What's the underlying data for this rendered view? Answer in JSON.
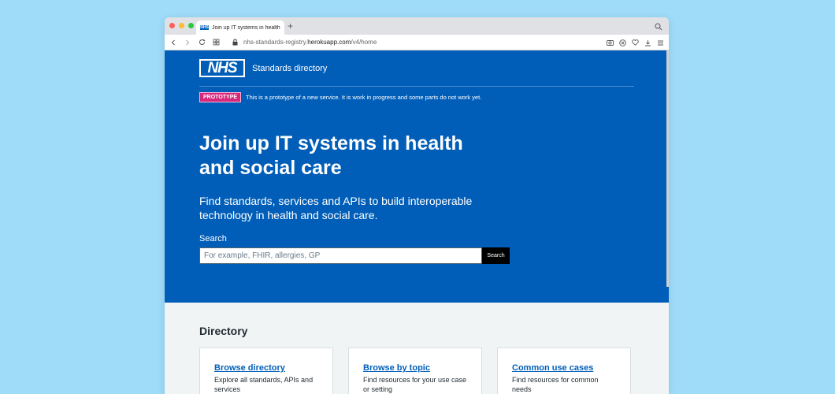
{
  "browser": {
    "tab_title": "Join up IT systems in health an",
    "favicon_text": "NHS",
    "new_tab": "+",
    "url_domain": "nhs-standards-registry.",
    "url_host": "herokuapp.com",
    "url_path": "/v4/home"
  },
  "header": {
    "logo": "NHS",
    "service_name": "Standards directory"
  },
  "banner": {
    "tag": "PROTOTYPE",
    "text": "This is a prototype of a new service. It is work in progress and some parts do not work yet."
  },
  "hero": {
    "title": "Join up IT systems in health and social care",
    "lead": "Find standards, services and APIs to build interoperable technology in health and social care."
  },
  "search": {
    "label": "Search",
    "placeholder": "For example, FHIR, allergies, GP",
    "button": "Search"
  },
  "directory": {
    "heading": "Directory",
    "cards": [
      {
        "title": "Browse directory",
        "description": "Explore all standards, APIs and services"
      },
      {
        "title": "Browse by topic",
        "description": "Find resources for your use case or setting"
      },
      {
        "title": "Common use cases",
        "description": "Find resources for common needs"
      }
    ]
  },
  "colors": {
    "nhs_blue": "#005eb8",
    "prototype_pink": "#d5287b",
    "background": "#9fdcf9"
  }
}
